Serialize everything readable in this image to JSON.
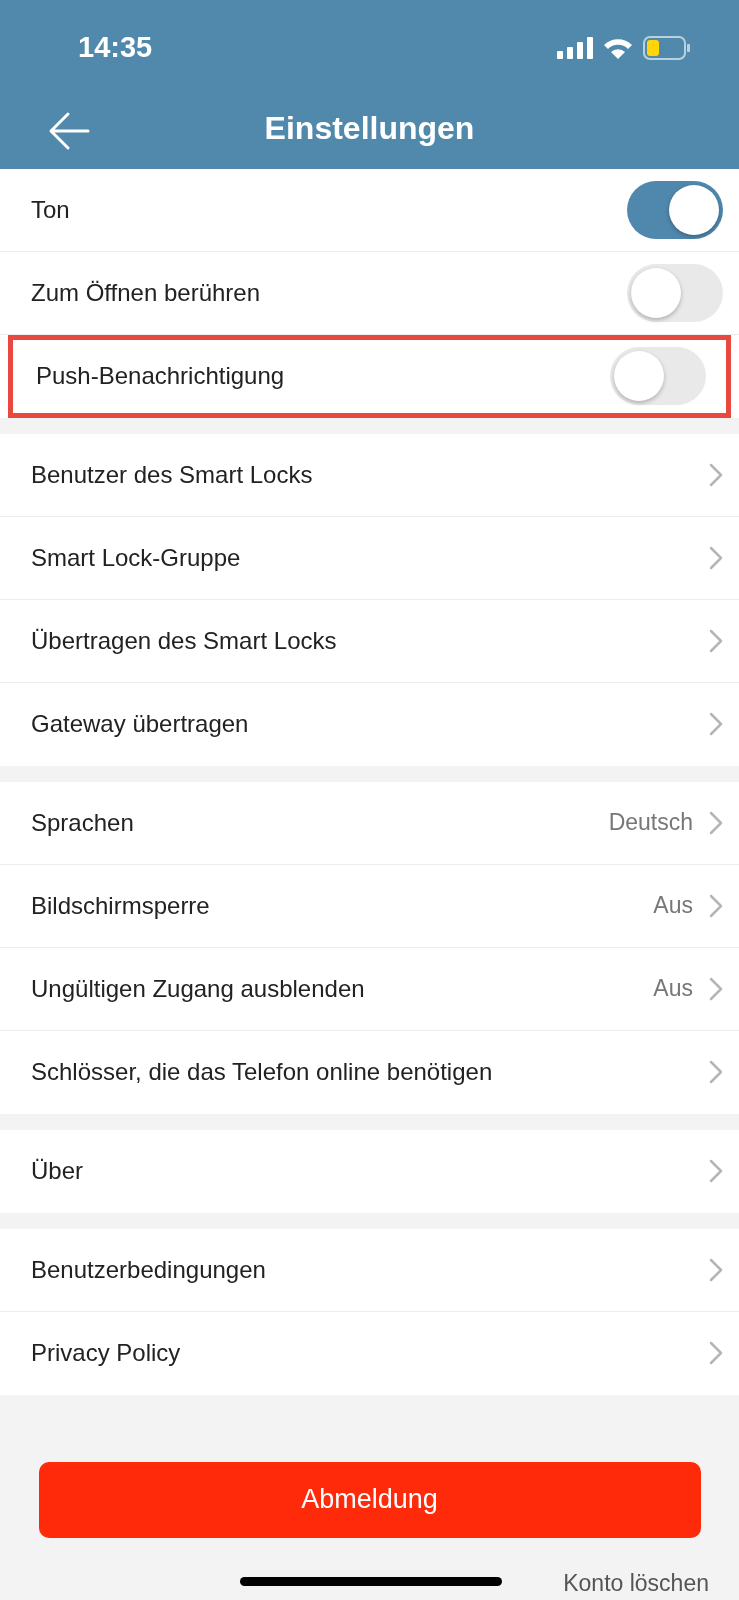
{
  "status_bar": {
    "time": "14:35"
  },
  "header": {
    "title": "Einstellungen"
  },
  "sections": [
    {
      "rows": [
        {
          "kind": "toggle",
          "label": "Ton",
          "on": true,
          "highlighted": false
        },
        {
          "kind": "toggle",
          "label": "Zum Öffnen berühren",
          "on": false,
          "highlighted": false
        },
        {
          "kind": "toggle",
          "label": "Push-Benachrichtigung",
          "on": false,
          "highlighted": true
        }
      ]
    },
    {
      "rows": [
        {
          "kind": "link",
          "label": "Benutzer des Smart Locks"
        },
        {
          "kind": "link",
          "label": "Smart Lock-Gruppe"
        },
        {
          "kind": "link",
          "label": "Übertragen des Smart Locks"
        },
        {
          "kind": "link",
          "label": "Gateway übertragen"
        }
      ]
    },
    {
      "rows": [
        {
          "kind": "link",
          "label": "Sprachen",
          "value": "Deutsch"
        },
        {
          "kind": "link",
          "label": "Bildschirmsperre",
          "value": "Aus"
        },
        {
          "kind": "link",
          "label": "Ungültigen Zugang ausblenden",
          "value": "Aus"
        },
        {
          "kind": "link",
          "label": "Schlösser, die das Telefon online benötigen"
        }
      ]
    },
    {
      "rows": [
        {
          "kind": "link",
          "label": "Über"
        }
      ]
    },
    {
      "rows": [
        {
          "kind": "link",
          "label": "Benutzerbedingungen"
        },
        {
          "kind": "link",
          "label": "Privacy Policy"
        }
      ]
    }
  ],
  "logout_button": "Abmeldung",
  "delete_account_link": "Konto löschen"
}
